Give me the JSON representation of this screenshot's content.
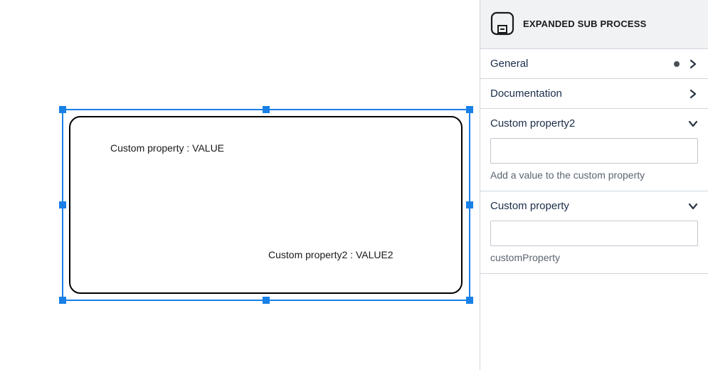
{
  "canvas": {
    "label1": "Custom property : VALUE",
    "label2": "Custom property2 : VALUE2"
  },
  "panel": {
    "title": "EXPANDED SUB PROCESS",
    "sections": {
      "general": {
        "label": "General"
      },
      "documentation": {
        "label": "Documentation"
      },
      "cp2": {
        "label": "Custom property2",
        "value": "",
        "helper": "Add a value to the custom property"
      },
      "cp": {
        "label": "Custom property",
        "value": "",
        "helper": "customProperty"
      }
    }
  }
}
